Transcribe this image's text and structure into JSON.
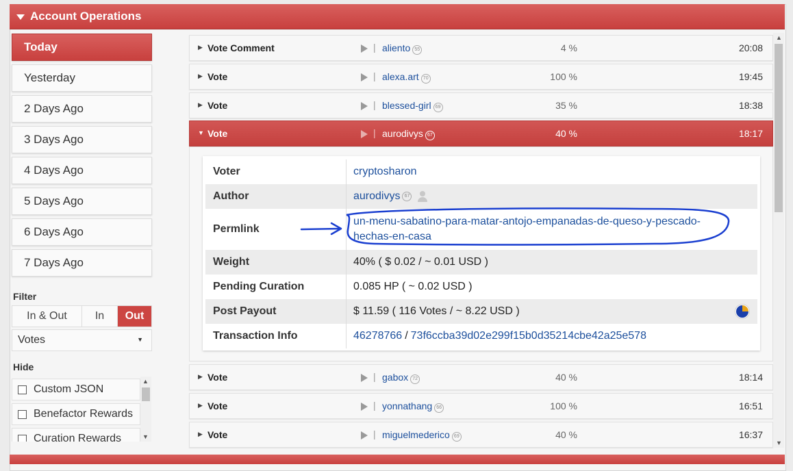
{
  "header": {
    "title": "Account Operations"
  },
  "sidebar": {
    "days": [
      "Today",
      "Yesterday",
      "2 Days Ago",
      "3 Days Ago",
      "4 Days Ago",
      "5 Days Ago",
      "6 Days Ago",
      "7 Days Ago"
    ],
    "active_day": "Today",
    "filter_label": "Filter",
    "filter_options": [
      "In & Out",
      "In",
      "Out"
    ],
    "filter_selected": "Out",
    "select_value": "Votes",
    "hide_label": "Hide",
    "hide_options": [
      "Custom JSON",
      "Benefactor Rewards",
      "Curation Rewards"
    ]
  },
  "operations": [
    {
      "type": "Vote Comment",
      "user": "aliento",
      "rep": "55",
      "percent": "4 %",
      "time": "20:08"
    },
    {
      "type": "Vote",
      "user": "alexa.art",
      "rep": "70",
      "percent": "100 %",
      "time": "19:45"
    },
    {
      "type": "Vote",
      "user": "blessed-girl",
      "rep": "69",
      "percent": "35 %",
      "time": "18:38"
    },
    {
      "type": "Vote",
      "user": "aurodivys",
      "rep": "67",
      "percent": "40 %",
      "time": "18:17"
    },
    {
      "type": "Vote",
      "user": "gabox",
      "rep": "72",
      "percent": "40 %",
      "time": "18:14"
    },
    {
      "type": "Vote",
      "user": "yonnathang",
      "rep": "66",
      "percent": "100 %",
      "time": "16:51"
    },
    {
      "type": "Vote",
      "user": "miguelmederico",
      "rep": "69",
      "percent": "40 %",
      "time": "16:37"
    }
  ],
  "detail": {
    "voter_label": "Voter",
    "voter": "cryptosharon",
    "author_label": "Author",
    "author": "aurodivys",
    "author_rep": "67",
    "permlink_label": "Permlink",
    "permlink_line1": "un-menu-sabatino-para-matar-antojo-empanadas-de-queso-y-pescado-",
    "permlink_line2": "hechas-en-casa",
    "weight_label": "Weight",
    "weight": "40% ( $ 0.02 / ~ 0.01 USD )",
    "pending_label": "Pending Curation",
    "pending": "0.085 HP ( ~ 0.02 USD )",
    "payout_label": "Post Payout",
    "payout": "$ 11.59 ( 116 Votes / ~ 8.22 USD )",
    "tx_label": "Transaction Info",
    "tx_block": "46278766",
    "tx_sep": "/",
    "tx_id": "73f6ccba39d02e299f15b0d35214cbe42a25e578"
  },
  "colors": {
    "accent": "#c8403e",
    "link": "#1c4f9c",
    "annotation": "#1a3fd0"
  }
}
